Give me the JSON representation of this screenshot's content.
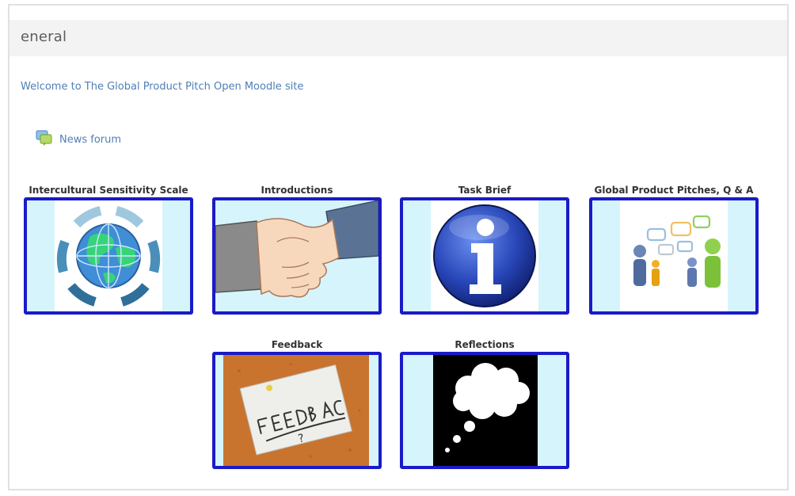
{
  "section": {
    "title": "eneral"
  },
  "welcome_text": "Welcome to The Global Product Pitch Open Moodle site",
  "news_forum": {
    "label": "News forum",
    "icon": "forum-icon"
  },
  "colors": {
    "tile_border": "#1a1ac8",
    "tile_bg": "#d6f4fb",
    "link": "#4f7fb5",
    "header_bg": "#f3f3f3"
  },
  "tiles": [
    {
      "label": "Intercultural Sensitivity Scale",
      "icon": "globe-icon"
    },
    {
      "label": "Introductions",
      "icon": "handshake-icon"
    },
    {
      "label": "Task Brief",
      "icon": "info-icon"
    },
    {
      "label": "Global Product Pitches, Q & A",
      "icon": "people-chat-icon"
    },
    {
      "label": "Feedback",
      "icon": "feedback-note-icon"
    },
    {
      "label": "Reflections",
      "icon": "thought-cloud-icon"
    }
  ]
}
